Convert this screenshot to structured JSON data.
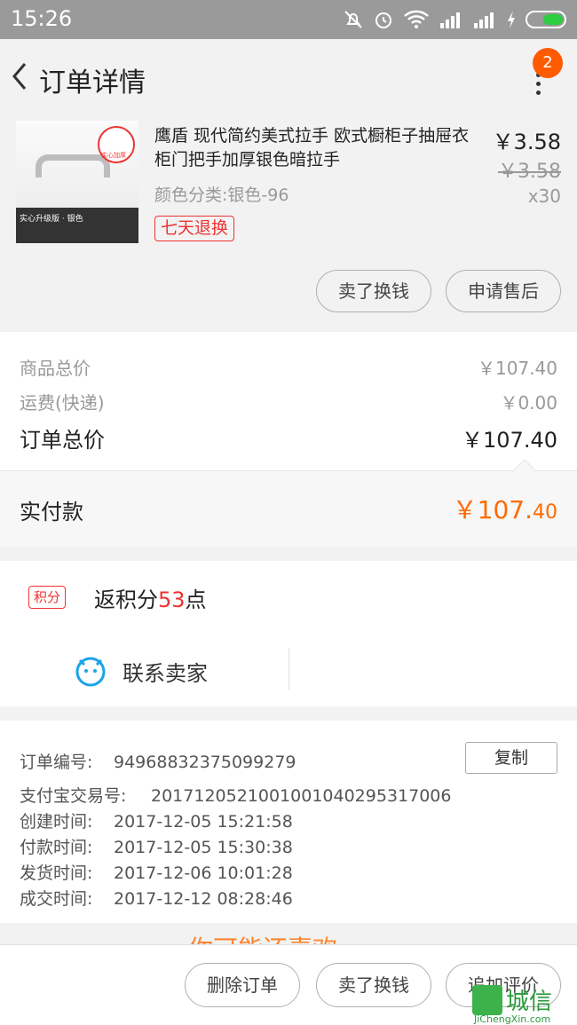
{
  "status_bar": {
    "time": "15:26"
  },
  "header": {
    "title": "订单详情",
    "badge_count": "2"
  },
  "product": {
    "name": "鹰盾 现代简约美式拉手 欧式橱柜子抽屉衣柜门把手加厚银色暗拉手",
    "sku": "颜色分类:银色-96",
    "tag": "七天退换",
    "price": "￥3.58",
    "original_price": "￥3.58",
    "quantity": "x30",
    "image_label": "实心升级版 · 银色",
    "image_badge": "实心加厚",
    "buttons": {
      "sell_exchange": "卖了换钱",
      "after_sale": "申请售后"
    }
  },
  "totals": {
    "items_label": "商品总价",
    "items_value": "￥107.40",
    "shipping_label": "运费(快递)",
    "shipping_value": "￥0.00",
    "order_total_label": "订单总价",
    "order_total_value": "￥107.40",
    "paid_label": "实付款",
    "paid_value_main": "￥107.",
    "paid_value_decimal": "40"
  },
  "points": {
    "tag": "积分",
    "text_before": "返积分",
    "number": "53",
    "text_after": "点"
  },
  "contact": {
    "label": "联系卖家"
  },
  "order_info": {
    "copy_label": "复制",
    "lines": [
      {
        "key": "订单编号:",
        "value": "94968832375099279"
      },
      {
        "key": "支付宝交易号:",
        "value": "2017120521001001040295317006"
      },
      {
        "key": "创建时间:",
        "value": "2017-12-05 15:21:58"
      },
      {
        "key": "付款时间:",
        "value": "2017-12-05 15:30:38"
      },
      {
        "key": "发货时间:",
        "value": "2017-12-06 10:01:28"
      },
      {
        "key": "成交时间:",
        "value": "2017-12-12 08:28:46"
      }
    ]
  },
  "peek_text": "你可能还喜欢",
  "bottom_bar": {
    "delete": "删除订单",
    "sell": "卖了换钱",
    "review": "追加评价"
  },
  "watermark": {
    "cn": "城信",
    "en": "JiChengXin.com"
  },
  "colors": {
    "accent": "#ff6a00",
    "red": "#e33333",
    "badge": "#ff5a00"
  }
}
